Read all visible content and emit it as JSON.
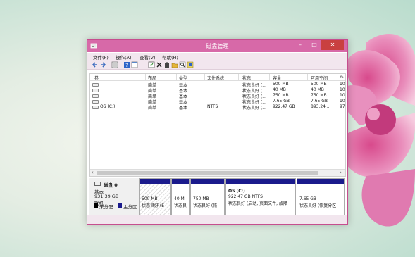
{
  "window": {
    "title": "磁盘管理",
    "minimize": "–",
    "maximize": "□",
    "close": "✕"
  },
  "menu": [
    "文件(F)",
    "操作(A)",
    "查看(V)",
    "帮助(H)"
  ],
  "toolbar_icons": [
    "back-icon",
    "forward-icon",
    "list-view-icon",
    "help-icon",
    "console-icon",
    "properties-icon",
    "delete-icon",
    "new-volume-icon",
    "open-icon",
    "search-icon",
    "refresh-icon"
  ],
  "columns": [
    "卷",
    "布局",
    "类型",
    "文件系统",
    "状态",
    "容量",
    "可用空间",
    "%"
  ],
  "rows": [
    {
      "vol": "",
      "layout": "简单",
      "type": "基本",
      "fs": "",
      "status": "状态良好 (...",
      "cap": "500 MB",
      "free": "500 MB",
      "pct": "10"
    },
    {
      "vol": "",
      "layout": "简单",
      "type": "基本",
      "fs": "",
      "status": "状态良好 (...",
      "cap": "40 MB",
      "free": "40 MB",
      "pct": "10"
    },
    {
      "vol": "",
      "layout": "简单",
      "type": "基本",
      "fs": "",
      "status": "状态良好 (...",
      "cap": "750 MB",
      "free": "750 MB",
      "pct": "10"
    },
    {
      "vol": "",
      "layout": "简单",
      "type": "基本",
      "fs": "",
      "status": "状态良好 (...",
      "cap": "7.65 GB",
      "free": "7.65 GB",
      "pct": "10"
    },
    {
      "vol": "OS (C:)",
      "layout": "简单",
      "type": "基本",
      "fs": "NTFS",
      "status": "状态良好 (...",
      "cap": "922.47 GB",
      "free": "893.24 ...",
      "pct": "97"
    }
  ],
  "scroll": {
    "left": "‹",
    "right": "›"
  },
  "disk": {
    "name": "磁盘 0",
    "type": "基本",
    "size": "931.39 GB",
    "state": "联机"
  },
  "partitions": [
    {
      "title": "",
      "size": "500 MB",
      "status": "状态良好 (E"
    },
    {
      "title": "",
      "size": "40 M",
      "status": "状态良"
    },
    {
      "title": "",
      "size": "750 MB",
      "status": "状态良好 (恢"
    },
    {
      "title": "OS  (C:)",
      "size": "922.47 GB NTFS",
      "status": "状态良好 (启动, 页面文件, 故障"
    },
    {
      "title": "",
      "size": "7.65 GB",
      "status": "状态良好 (恢复分区"
    }
  ],
  "legend": [
    {
      "label": "未分配",
      "color": "#000000"
    },
    {
      "label": "主分区",
      "color": "#1a1a8c"
    }
  ],
  "colors": {
    "titlebar": "#d769a8",
    "partition_bar": "#1a1a8c"
  }
}
